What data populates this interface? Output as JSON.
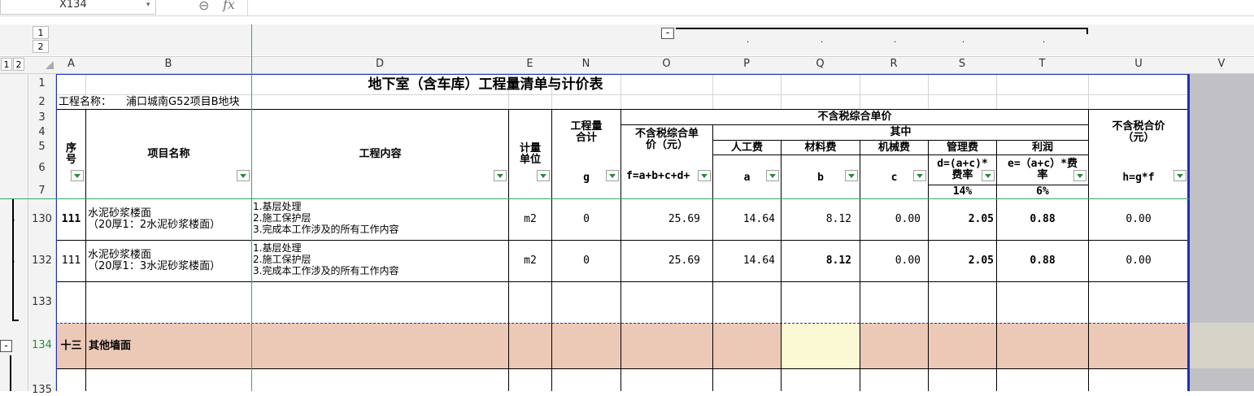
{
  "formula_bar": {
    "name_box": "X134",
    "fx_label": "fx",
    "formula": ""
  },
  "outline": {
    "levels": [
      "1",
      "2"
    ],
    "row_levels": [
      "1",
      "2"
    ],
    "collapse_symbol": "-",
    "row_dots": [
      "·",
      "·",
      "·"
    ]
  },
  "columns": [
    "A",
    "B",
    "D",
    "E",
    "N",
    "O",
    "P",
    "Q",
    "R",
    "S",
    "T",
    "U",
    "V"
  ],
  "row_numbers": [
    "1",
    "2",
    "3",
    "4",
    "5",
    "6",
    "7",
    "130",
    "132",
    "133",
    "134",
    "135"
  ],
  "sheet": {
    "title": "地下室（含车库）工程量清单与计价表",
    "project_label": "工程名称：",
    "project_name": "浦口城南G52项目B地块",
    "headers": {
      "seq": "序\n号",
      "item_name": "项目名称",
      "work_content": "工程内容",
      "unit": "计量\n单位",
      "quantity_total": "工程量\n合计",
      "unit_price_group": "不含税综合单价",
      "unit_price": "不含税综合单\n价（元）",
      "of_which": "其中",
      "labor": "人工费",
      "material": "材料费",
      "machine": "机械费",
      "mgmt": "管理费",
      "profit": "利润",
      "total_price": "不含税合价\n（元）",
      "g": "g",
      "f_formula": "f=a+b+c+d+",
      "a": "a",
      "b": "b",
      "c": "c",
      "d_formula": "d=(a+c)*\n费率",
      "e_formula": "e=（a+c）*费\n率",
      "h_formula": "h=g*f",
      "mgmt_rate": "14%",
      "profit_rate": "6%"
    },
    "rows": [
      {
        "seq": "111",
        "name": "水泥砂浆楼面\n（20厚1：2水泥砂浆楼面）",
        "content": "1.基层处理\n2.施工保护层\n3.完成本工作涉及的所有工作内容",
        "unit": "m2",
        "qty": "0",
        "f": "25.69",
        "a": "14.64",
        "b": "8.12",
        "c": "0.00",
        "d": "2.05",
        "e": "0.88",
        "h": "0.00"
      },
      {
        "seq": "111",
        "name": "水泥砂浆楼面\n（20厚1：3水泥砂浆楼面）",
        "content": "1.基层处理\n2.施工保护层\n3.完成本工作涉及的所有工作内容",
        "unit": "m2",
        "qty": "0",
        "f": "25.69",
        "a": "14.64",
        "b": "8.12",
        "c": "0.00",
        "d": "2.05",
        "e": "0.88",
        "h": "0.00"
      }
    ],
    "section_row": {
      "seq": "十三",
      "name": "其他墙面"
    }
  },
  "colors": {
    "section_fill": "#ecc9b7",
    "selected_cell": "#fbf8d4",
    "gray_area": "#c1c0c4",
    "frozen_line": "#3aa56b",
    "border_blue": "#1f2fb8"
  }
}
